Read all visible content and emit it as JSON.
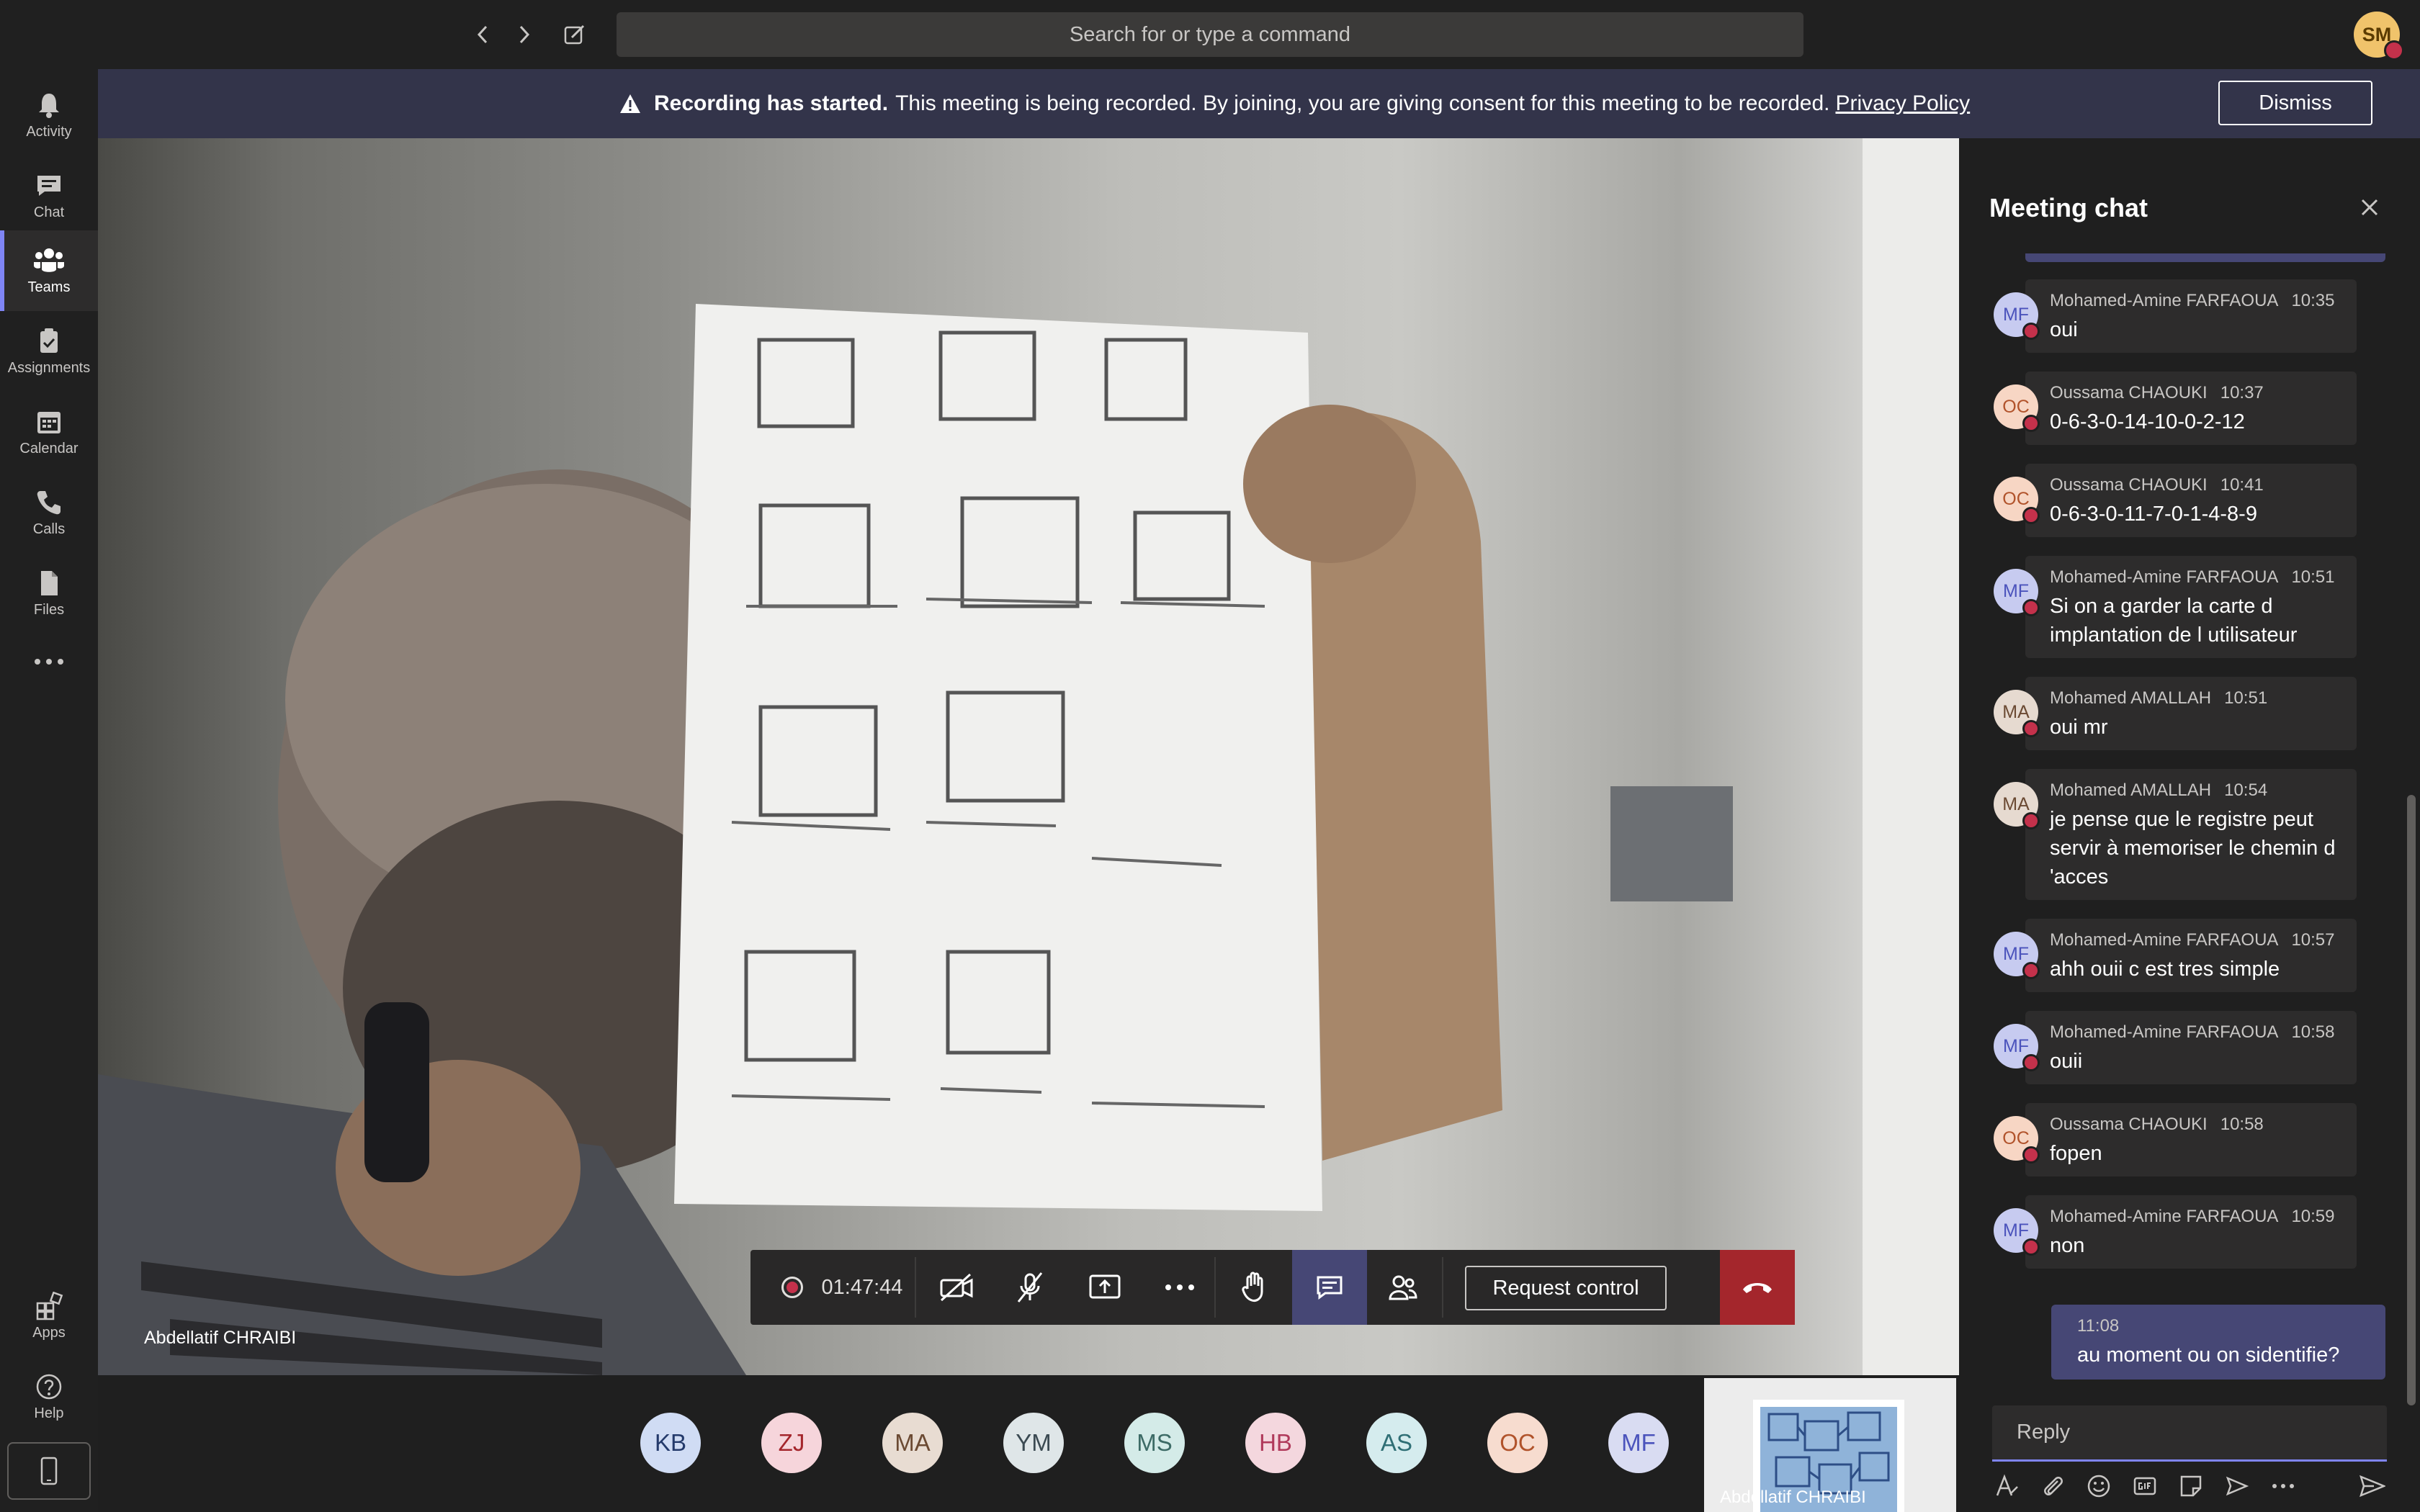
{
  "search": {
    "placeholder": "Search for or type a command"
  },
  "me": {
    "initials": "SM"
  },
  "rail": {
    "items": [
      {
        "label": "Activity",
        "icon": "bell-icon"
      },
      {
        "label": "Chat",
        "icon": "chat-icon"
      },
      {
        "label": "Teams",
        "icon": "teams-icon",
        "active": true
      },
      {
        "label": "Assignments",
        "icon": "assignments-icon"
      },
      {
        "label": "Calendar",
        "icon": "calendar-icon"
      },
      {
        "label": "Calls",
        "icon": "phone-icon"
      },
      {
        "label": "Files",
        "icon": "file-icon"
      }
    ],
    "apps_label": "Apps",
    "help_label": "Help"
  },
  "banner": {
    "bold": "Recording has started.",
    "text": "This meeting is being recorded. By joining, you are giving consent for this meeting to be recorded.",
    "link": "Privacy Policy",
    "dismiss": "Dismiss"
  },
  "video": {
    "speaker": "Abdellatif CHRAIBI"
  },
  "controls": {
    "timer": "01:47:44",
    "request_control": "Request control"
  },
  "participants": [
    {
      "initials": "KB",
      "bg": "#d0dcf4",
      "fg": "#243a6b"
    },
    {
      "initials": "ZJ",
      "bg": "#f6d5db",
      "fg": "#a4262c"
    },
    {
      "initials": "MA",
      "bg": "#e8dcd2",
      "fg": "#6b4a33"
    },
    {
      "initials": "YM",
      "bg": "#dfe6e8",
      "fg": "#3b4a52"
    },
    {
      "initials": "MS",
      "bg": "#d4ebe8",
      "fg": "#3d6b66"
    },
    {
      "initials": "HB",
      "bg": "#f4d7de",
      "fg": "#b03a5b"
    },
    {
      "initials": "AS",
      "bg": "#d5ecee",
      "fg": "#2f6f75"
    },
    {
      "initials": "OC",
      "bg": "#f7dccf",
      "fg": "#b1532b"
    },
    {
      "initials": "MF",
      "bg": "#d9dcf2",
      "fg": "#4b53bc"
    }
  ],
  "thumbnail": {
    "name": "Abdellatif CHRAIBI"
  },
  "chat": {
    "title": "Meeting chat",
    "messages": [
      {
        "initials": "MF",
        "author": "Mohamed-Amine FARFAOUA",
        "time": "10:35",
        "lines": [
          "oui"
        ]
      },
      {
        "initials": "OC",
        "author": "Oussama CHAOUKI",
        "time": "10:37",
        "lines": [
          "0-6-3-0-14-10-0-2-12"
        ]
      },
      {
        "initials": "OC",
        "author": "Oussama CHAOUKI",
        "time": "10:41",
        "lines": [
          "0-6-3-0-11-7-0-1-4-8-9"
        ]
      },
      {
        "initials": "MF",
        "author": "Mohamed-Amine FARFAOUA",
        "time": "10:51",
        "lines": [
          "Si on a garder la carte d",
          "implantation de l utilisateur"
        ]
      },
      {
        "initials": "MA",
        "author": "Mohamed AMALLAH",
        "time": "10:51",
        "lines": [
          "oui mr"
        ]
      },
      {
        "initials": "MA",
        "author": "Mohamed AMALLAH",
        "time": "10:54",
        "lines": [
          "je pense que le registre peut",
          "servir à memoriser le chemin d",
          "'acces"
        ]
      },
      {
        "initials": "MF",
        "author": "Mohamed-Amine FARFAOUA",
        "time": "10:57",
        "lines": [
          "ahh ouii c est tres simple"
        ]
      },
      {
        "initials": "MF",
        "author": "Mohamed-Amine FARFAOUA",
        "time": "10:58",
        "lines": [
          "ouii"
        ]
      },
      {
        "initials": "OC",
        "author": "Oussama CHAOUKI",
        "time": "10:58",
        "lines": [
          "fopen"
        ]
      },
      {
        "initials": "MF",
        "author": "Mohamed-Amine FARFAOUA",
        "time": "10:59",
        "lines": [
          "non"
        ]
      }
    ],
    "my_message": {
      "time": "11:08",
      "text": "au moment ou on sidentifie?"
    },
    "reply_placeholder": "Reply",
    "compose_icons": [
      "format-icon",
      "attach-icon",
      "emoji-icon",
      "gif-icon",
      "sticker-icon",
      "schedule-icon",
      "more-icon",
      "send-icon"
    ]
  }
}
